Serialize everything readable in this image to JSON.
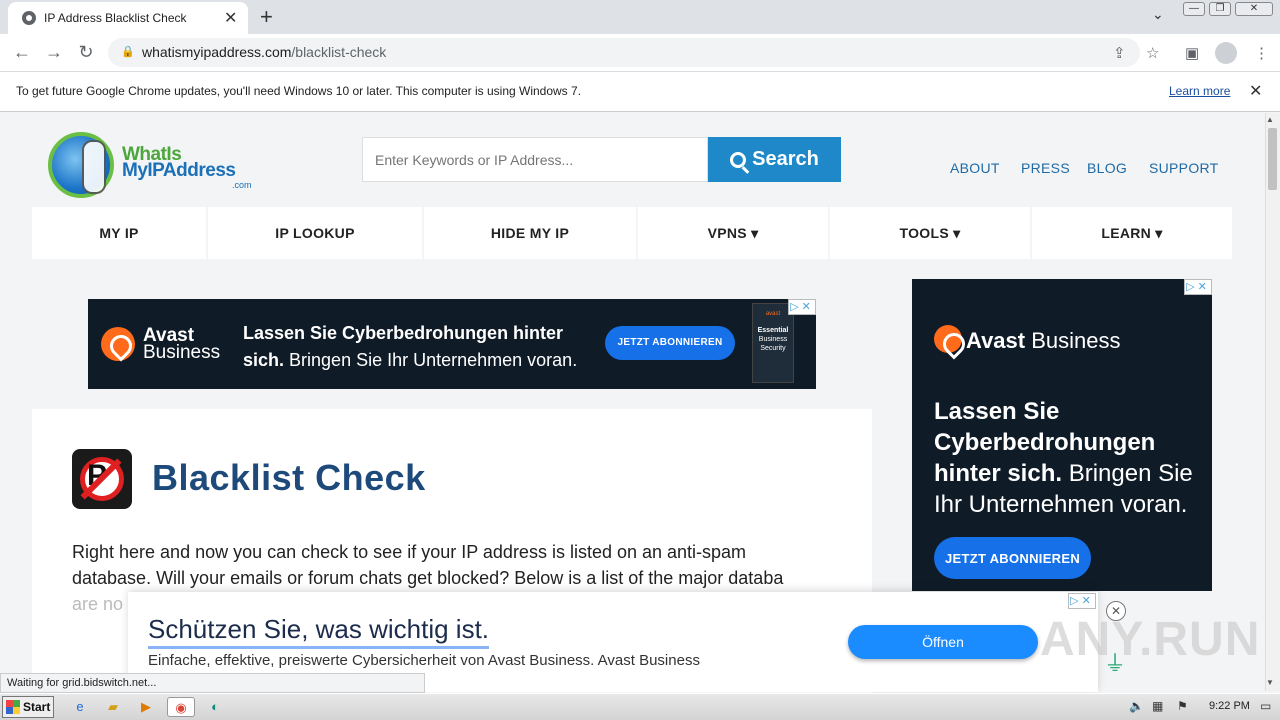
{
  "browser": {
    "tab_title": "IP Address Blacklist Check",
    "url_domain": "whatismyipaddress.com",
    "url_path": "/blacklist-check",
    "infobar_text": "To get future Google Chrome updates, you'll need Windows 10 or later. This computer is using Windows 7.",
    "infobar_link": "Learn more",
    "status_text": "Waiting for grid.bidswitch.net..."
  },
  "site": {
    "logo_line1": "WhatIs",
    "logo_line2": "MyIPAddress",
    "logo_suffix": ".com",
    "search_placeholder": "Enter Keywords or IP Address...",
    "search_button": "Search",
    "top_links": [
      "ABOUT",
      "PRESS",
      "BLOG",
      "SUPPORT"
    ],
    "nav": [
      {
        "label": "MY IP"
      },
      {
        "label": "IP LOOKUP"
      },
      {
        "label": "HIDE MY IP"
      },
      {
        "label": "VPNS ▾"
      },
      {
        "label": "TOOLS ▾"
      },
      {
        "label": "LEARN ▾"
      }
    ]
  },
  "ads": {
    "banner": {
      "brand_line1": "Avast",
      "brand_line2": "Business",
      "headline_bold1": "Lassen Sie Cyberbedrohungen hinter",
      "headline_bold2": "sich.",
      "headline_rest": " Bringen Sie Ihr Unternehmen voran.",
      "cta": "JETZT ABONNIEREN",
      "box_brand": "avast",
      "box_title": "Essential",
      "box_sub": "Business Security"
    },
    "side": {
      "brand": "Avast",
      "brand_rest": " Business",
      "headline_bold": "Lassen Sie Cyberbedrohungen hinter sich.",
      "headline_rest": " Bringen Sie Ihr Unternehmen voran.",
      "cta": "JETZT ABONNIEREN"
    },
    "bottom": {
      "headline": "Schützen Sie, was wichtig ist.",
      "subline": "Einfache, effektive, preiswerte Cybersicherheit von Avast Business. Avast Business",
      "button": "Öffnen"
    }
  },
  "content": {
    "title": "Blacklist Check",
    "intro": "Right here and now you can check to see if your IP address is listed on an anti-spam database. Will your emails or forum chats get blocked? Below is a list of the major databa",
    "intro_tail": "are no"
  },
  "watermark": "ANY.RUN",
  "taskbar": {
    "start_label": "Start",
    "clock": "9:22 PM"
  }
}
